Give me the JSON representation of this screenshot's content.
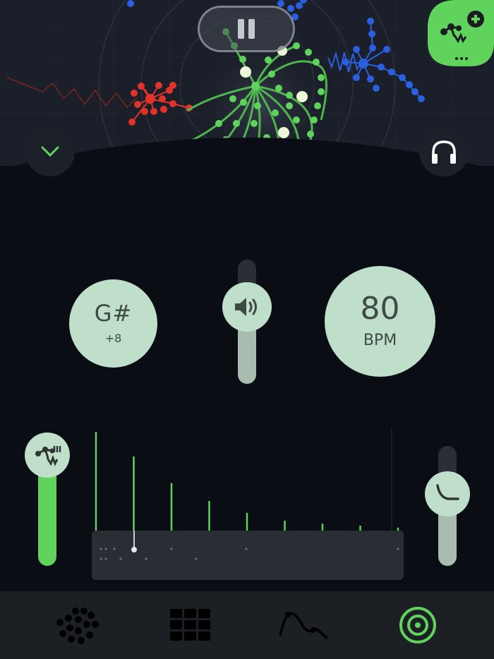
{
  "pitch": {
    "note": "G#",
    "cents": "+8"
  },
  "tempo": {
    "value": "80",
    "unit": "BPM"
  },
  "volume_level": 0.55,
  "density_level": 0.78,
  "decay_level": 0.55,
  "harmonics": [
    1.0,
    0.75,
    0.48,
    0.3,
    0.18,
    0.1,
    0.07,
    0.05,
    0.03
  ],
  "colors": {
    "accent_green": "#5fd35c",
    "knob": "#bfdfcb",
    "red_cluster": "#e2332b",
    "blue_cluster": "#2a5fe0",
    "tab_bar": "#1c1f24"
  },
  "icons": {
    "pause": "pause-icon",
    "add_network": "add-network-icon",
    "collapse": "chevron-down-icon",
    "headphones": "headphones-icon",
    "volume": "speaker-icon",
    "density": "network-wave-icon",
    "decay": "decay-curve-icon"
  },
  "tabs": [
    {
      "id": "network",
      "icon": "dots-cluster-icon",
      "active": false
    },
    {
      "id": "grid",
      "icon": "grid-icon",
      "active": false
    },
    {
      "id": "curve",
      "icon": "curve-icon",
      "active": false
    },
    {
      "id": "target",
      "icon": "target-icon",
      "active": true
    }
  ]
}
